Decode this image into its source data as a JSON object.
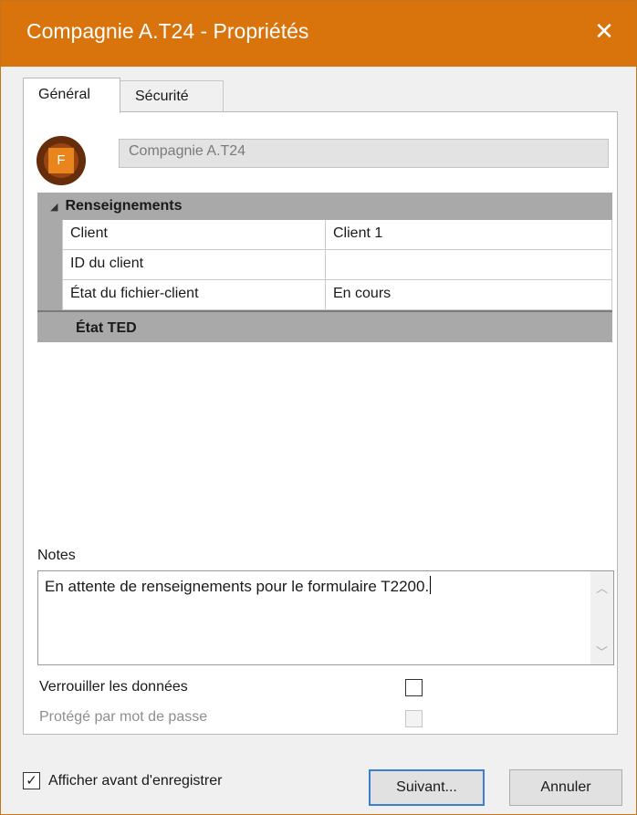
{
  "window": {
    "title": "Compagnie A.T24 - Propriétés",
    "close_glyph": "✕"
  },
  "tabs": [
    {
      "label": "Général",
      "active": true
    },
    {
      "label": "Sécurité",
      "active": false
    }
  ],
  "header": {
    "avatar_letter": "F",
    "name_value": "Compagnie A.T24"
  },
  "properties": {
    "group1_title": "Renseignements",
    "rows": [
      {
        "label": "Client",
        "value": "Client 1"
      },
      {
        "label": "ID du client",
        "value": ""
      },
      {
        "label": "État du fichier-client",
        "value": "En cours"
      }
    ],
    "group2_title": "État TED"
  },
  "notes": {
    "label": "Notes",
    "value": "En attente de renseignements pour le formulaire T2200."
  },
  "options": {
    "lock_label": "Verrouiller les données",
    "lock_checked": false,
    "password_label": "Protégé par mot de passe",
    "password_checked": false,
    "password_enabled": false
  },
  "footer": {
    "show_before_save_label": "Afficher avant d'enregistrer",
    "show_before_save_checked": true,
    "next_label": "Suivant...",
    "cancel_label": "Annuler"
  },
  "colors": {
    "titlebar": "#d9730c",
    "group_header": "#a9a9a9",
    "focus_border": "#3c7fd1"
  }
}
